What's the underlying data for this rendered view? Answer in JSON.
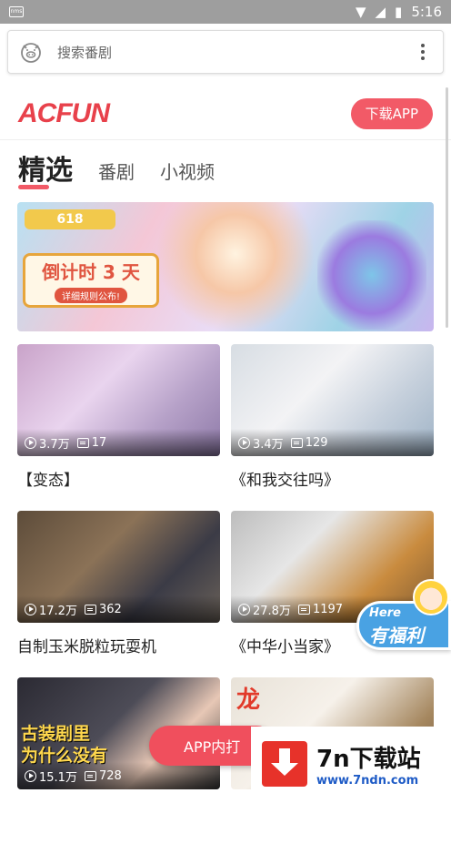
{
  "status_bar": {
    "time": "5:16",
    "app_icon": "nms"
  },
  "search": {
    "placeholder": "搜索番剧"
  },
  "header": {
    "logo": "ACFUN",
    "download_button": "下载APP"
  },
  "tabs": [
    {
      "label": "精选",
      "active": true
    },
    {
      "label": "番剧",
      "active": false
    },
    {
      "label": "小视频",
      "active": false
    }
  ],
  "banner": {
    "event_text": "618",
    "countdown": "倒计时 3 天",
    "sub": "详细规则公布!"
  },
  "videos": [
    {
      "views": "3.7万",
      "comments": "17",
      "title": "【变态】"
    },
    {
      "views": "3.4万",
      "comments": "129",
      "title": "《和我交往吗》"
    },
    {
      "views": "17.2万",
      "comments": "362",
      "title": "自制玉米脱粒玩耍机"
    },
    {
      "views": "27.8万",
      "comments": "1197",
      "title": "《中华小当家》"
    },
    {
      "views": "15.1万",
      "comments": "728",
      "title": "",
      "overlay": "古装剧里\n为什么没有"
    },
    {
      "views": "",
      "comments": "",
      "title": "",
      "overlay": "龙"
    }
  ],
  "promo": {
    "here": "Here",
    "label": "有福利"
  },
  "open_app_button": "APP内打",
  "watermark": {
    "name": "7n下载站",
    "url": "www.7ndn.com"
  }
}
